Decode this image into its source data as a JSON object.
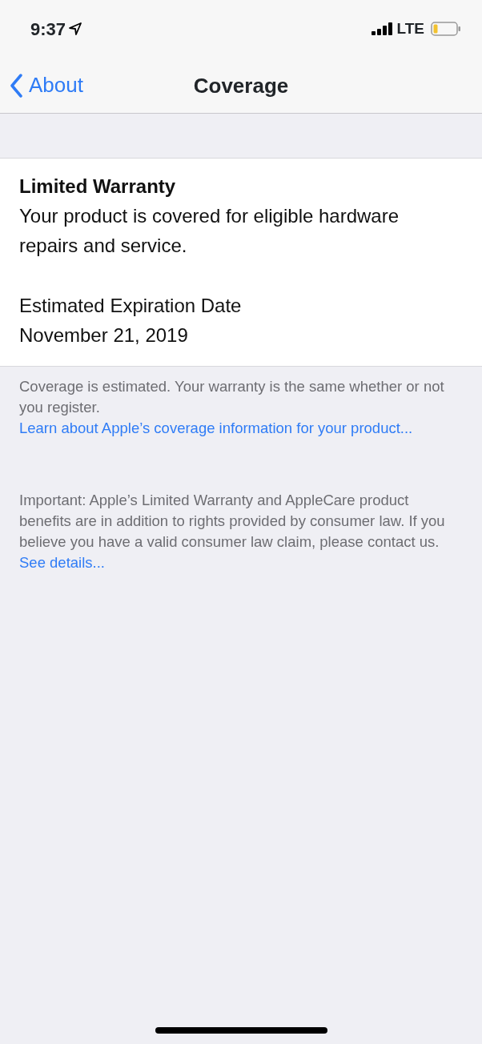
{
  "status_bar": {
    "time": "9:37",
    "network": "LTE"
  },
  "nav_bar": {
    "back_label": "About",
    "title": "Coverage"
  },
  "warranty": {
    "title": "Limited Warranty",
    "description": "Your product is covered for eligible hardware repairs and service.",
    "expiration_label": "Estimated Expiration Date",
    "expiration_date": "November 21, 2019"
  },
  "footnotes": [
    {
      "text": "Coverage is estimated. Your warranty is the same whether or not you register.",
      "link": "Learn about Apple’s coverage information for your product..."
    },
    {
      "text": "Important: Apple’s Limited Warranty and AppleCare product benefits are in addition to rights provided by consumer law. If you believe you have a valid consumer law claim, please contact us.",
      "link": "See details..."
    }
  ]
}
